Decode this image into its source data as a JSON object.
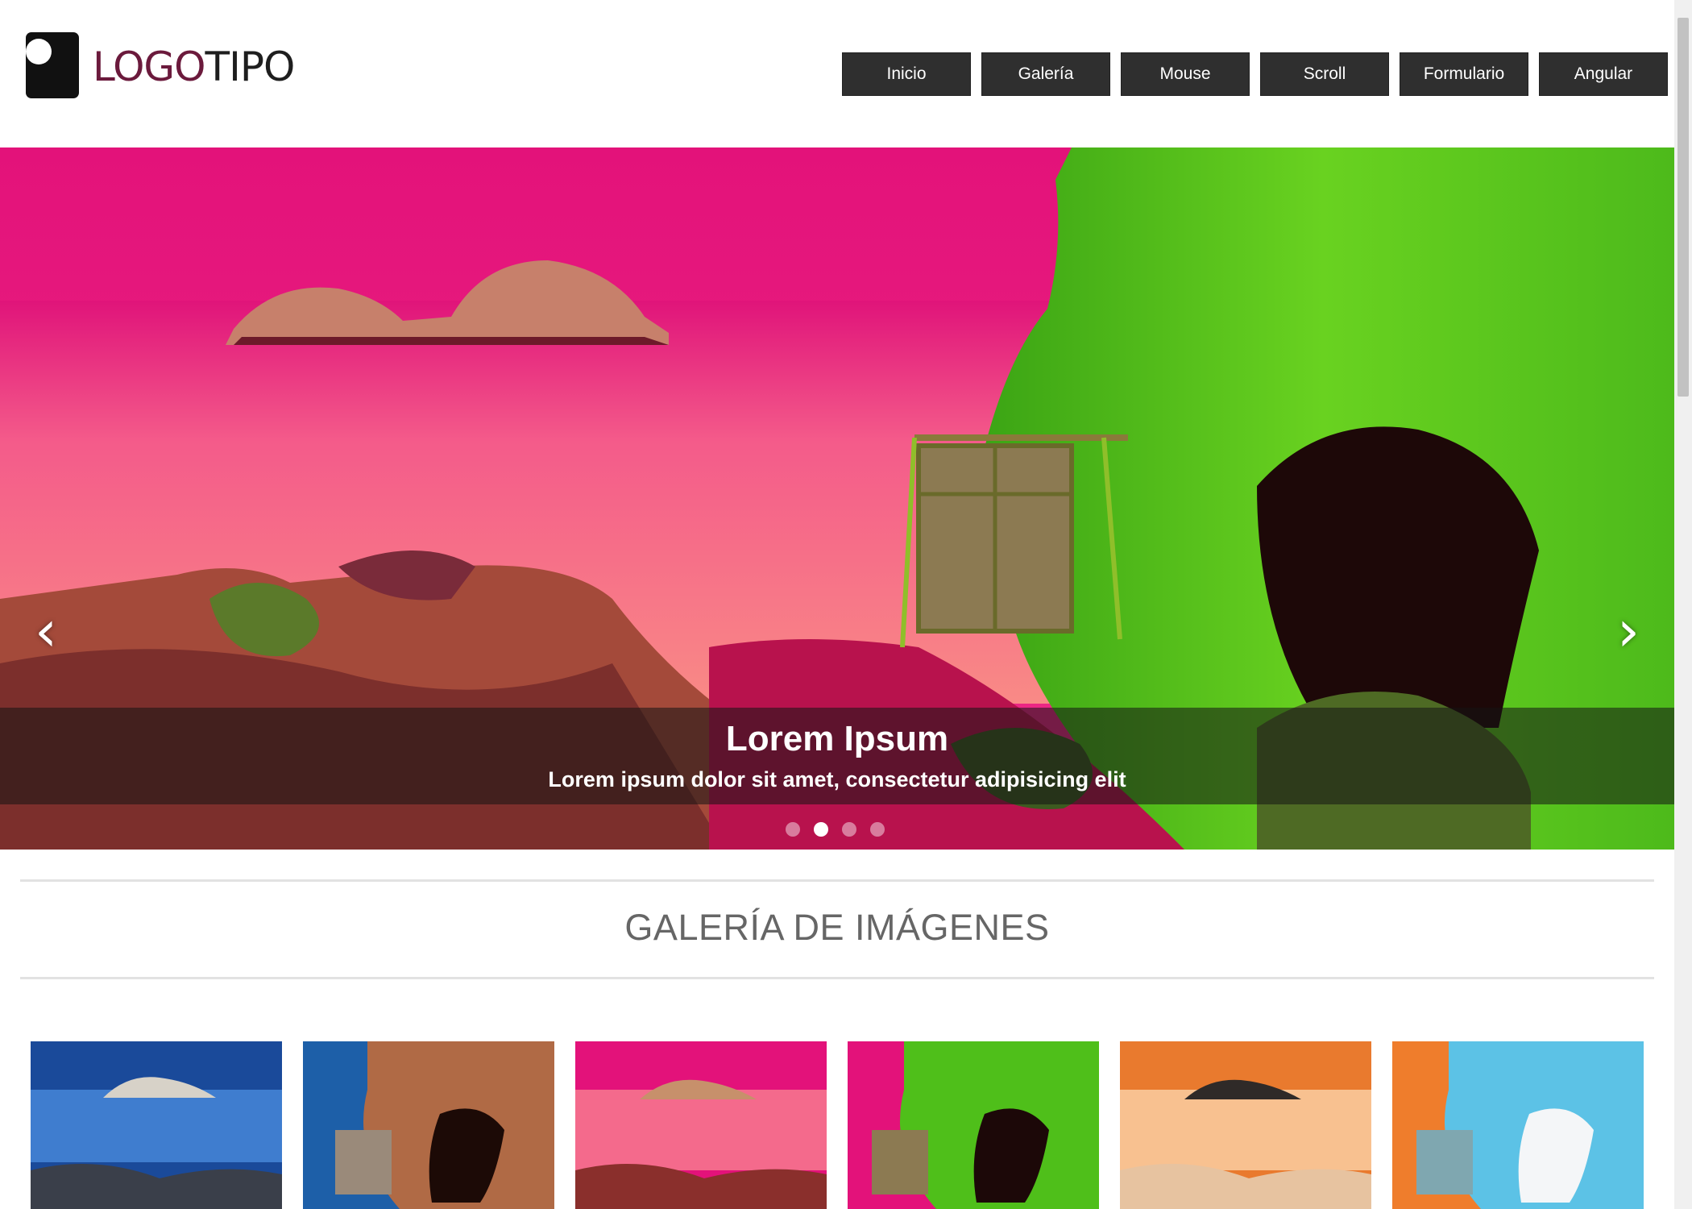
{
  "header": {
    "logo_part1": "LOGO",
    "logo_part2": "TIPO",
    "nav": [
      "Inicio",
      "Galería",
      "Mouse",
      "Scroll",
      "Formulario",
      "Angular"
    ]
  },
  "slider": {
    "prev_icon": "‹",
    "next_icon": "›",
    "caption_title": "Lorem Ipsum",
    "caption_text": "Lorem ipsum dolor sit amet, consectetur adipisicing elit",
    "active_slide": 2,
    "slide_count": 4
  },
  "gallery": {
    "title": "GALERÍA DE IMÁGENES",
    "thumbs": [
      {
        "name": "thumb-blue-sea"
      },
      {
        "name": "thumb-blue-cave"
      },
      {
        "name": "thumb-pink-sea"
      },
      {
        "name": "thumb-pink-cave"
      },
      {
        "name": "thumb-orange-sea"
      },
      {
        "name": "thumb-cyan-cave"
      }
    ]
  },
  "colors": {
    "nav_bg": "#2f2f2f",
    "logo_accent": "#6b1a3c",
    "slide_sky": "#e5107a",
    "slide_cliff": "#4fbf1a"
  }
}
